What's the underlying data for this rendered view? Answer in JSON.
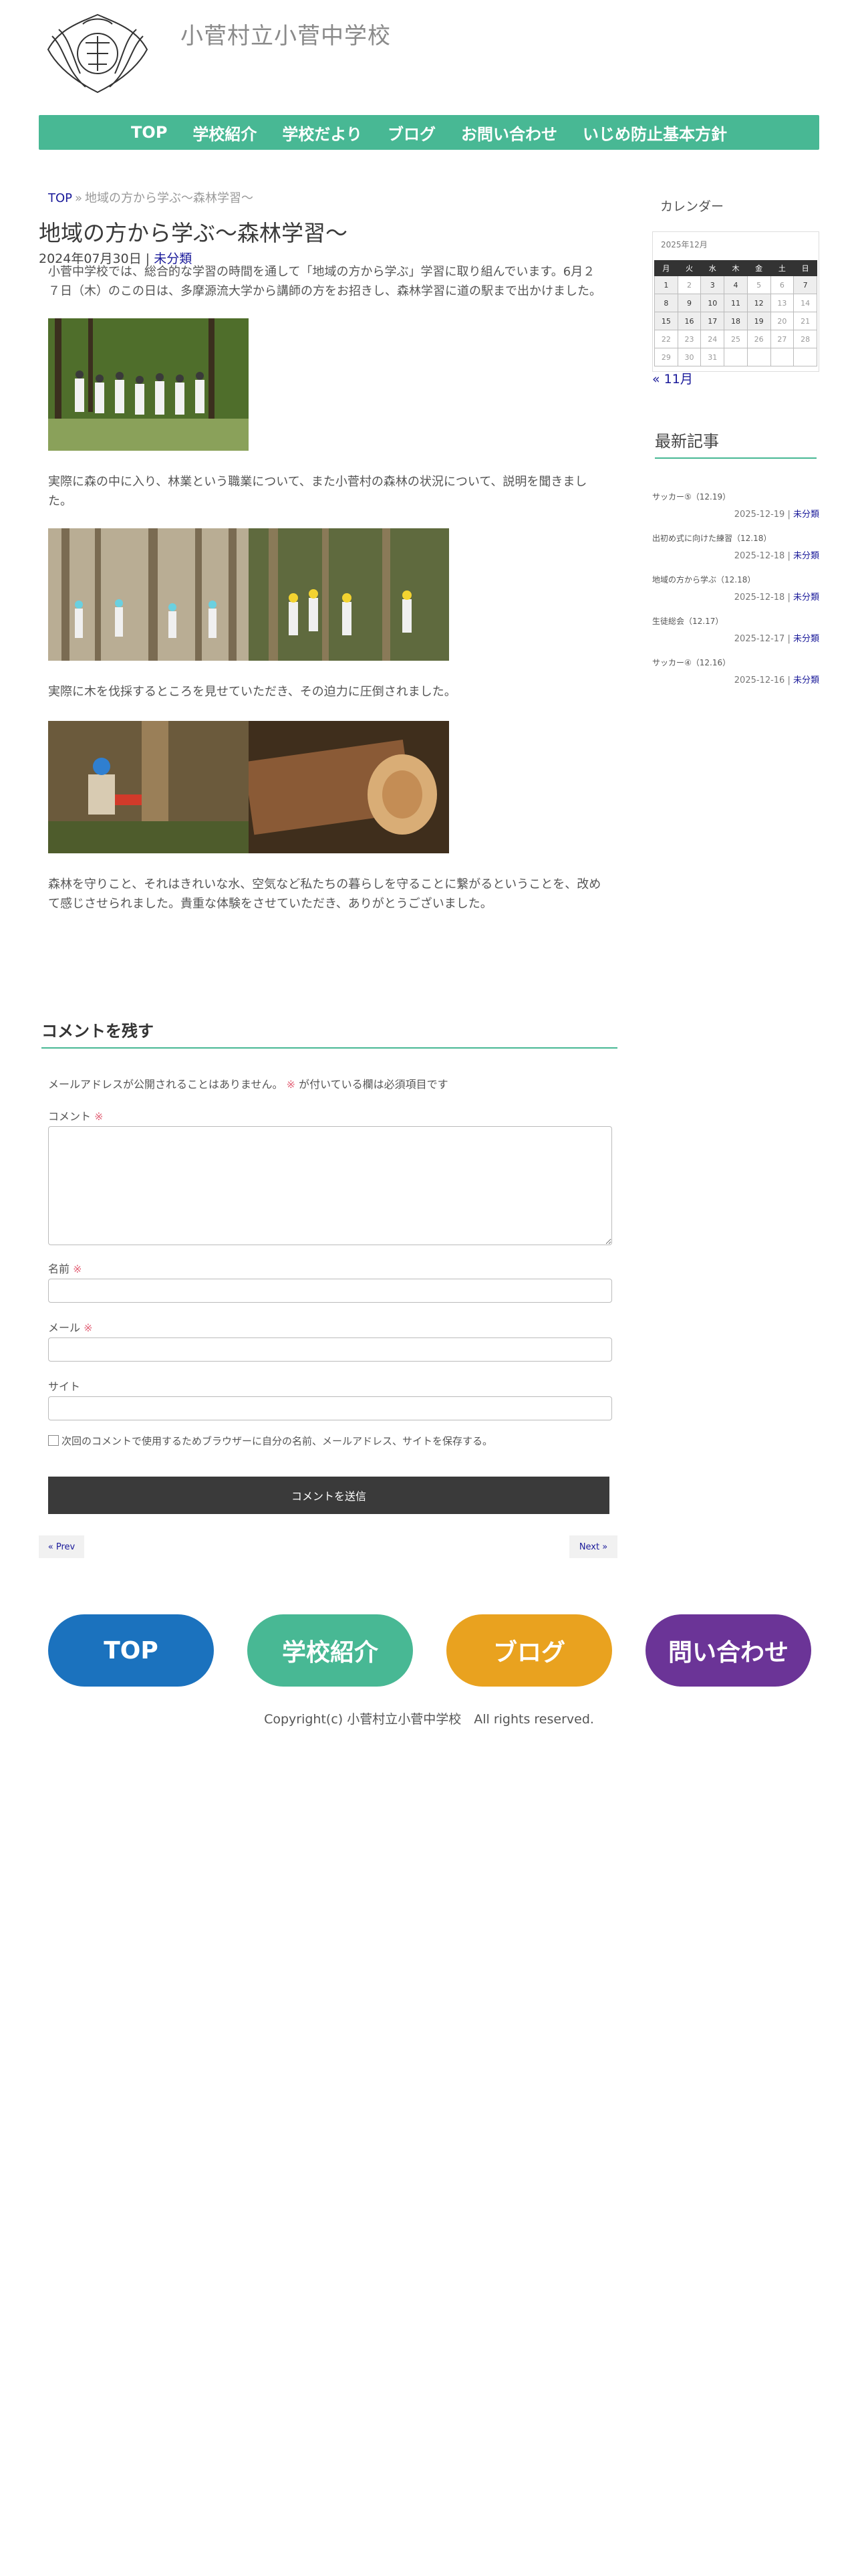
{
  "site": {
    "title": "小菅村立小菅中学校"
  },
  "nav": {
    "items": [
      "TOP",
      "学校紹介",
      "学校だより",
      "ブログ",
      "お問い合わせ",
      "いじめ防止基本方針"
    ]
  },
  "breadcrumb": {
    "home": "TOP",
    "sep": "»",
    "current": "地域の方から学ぶ〜森林学習〜"
  },
  "post": {
    "title": "地域の方から学ぶ〜森林学習〜",
    "date": "2024年07月30日",
    "meta_sep": "|",
    "category": "未分類",
    "paragraphs": [
      "小菅中学校では、総合的な学習の時間を通して「地域の方から学ぶ」学習に取り組んでいます。6月２７日（木）のこの日は、多摩源流大学から講師の方をお招きし、森林学習に道の駅まで出かけました。",
      "実際に森の中に入り、林業という職業について、また小菅村の森林の状況について、説明を聞きました。",
      "実際に木を伐採するところを見せていただき、その迫力に圧倒されました。",
      "森林を守りこと、それはきれいな水、空気など私たちの暮らしを守ることに繋がるということを、改めて感じさせられました。貴重な体験をさせていただき、ありがとうございました。"
    ]
  },
  "comments": {
    "heading": "コメントを残す",
    "notes_before": "メールアドレスが公開されることはありません。",
    "required_mark": "※",
    "notes_after": "が付いている欄は必須項目です",
    "comment_label": "コメント",
    "name_label": "名前",
    "email_label": "メール",
    "site_label": "サイト",
    "save_label": "次回のコメントで使用するためブラウザーに自分の名前、メールアドレス、サイトを保存する。",
    "submit_label": "コメントを送信"
  },
  "pager": {
    "prev": "« Prev",
    "next": "Next »"
  },
  "sidebar": {
    "calendar_heading": "カレンダー",
    "calendar_caption": "2025年12月",
    "weekdays": [
      "月",
      "火",
      "水",
      "木",
      "金",
      "土",
      "日"
    ],
    "weeks": [
      [
        "1",
        "2",
        "3",
        "4",
        "5",
        "6",
        "7"
      ],
      [
        "8",
        "9",
        "10",
        "11",
        "12",
        "13",
        "14"
      ],
      [
        "15",
        "16",
        "17",
        "18",
        "19",
        "20",
        "21"
      ],
      [
        "22",
        "23",
        "24",
        "25",
        "26",
        "27",
        "28"
      ],
      [
        "29",
        "30",
        "31",
        "",
        "",
        "",
        ""
      ]
    ],
    "days_with_posts": [
      "1",
      "3",
      "4",
      "7",
      "8",
      "9",
      "10",
      "11",
      "12",
      "15",
      "16",
      "17",
      "18",
      "19"
    ],
    "prev_month": "« 11月",
    "recent_heading": "最新記事",
    "recent_posts": [
      {
        "title": "サッカー⑤（12.19）",
        "date": "2025-12-19",
        "category": "未分類"
      },
      {
        "title": "出初め式に向けた練習（12.18）",
        "date": "2025-12-18",
        "category": "未分類"
      },
      {
        "title": "地域の方から学ぶ（12.18）",
        "date": "2025-12-18",
        "category": "未分類"
      },
      {
        "title": "生徒総会（12.17）",
        "date": "2025-12-17",
        "category": "未分類"
      },
      {
        "title": "サッカー④（12.16）",
        "date": "2025-12-16",
        "category": "未分類"
      }
    ]
  },
  "footer": {
    "buttons": [
      "TOP",
      "学校紹介",
      "ブログ",
      "問い合わせ"
    ],
    "colors": [
      "#1b72be",
      "#48b894",
      "#e9a21f",
      "#6b3497"
    ],
    "copyright": "Copyright(c) 小菅村立小菅中学校　All rights reserved."
  },
  "colors": {
    "accent": "#48b894",
    "link": "#1a1a9a",
    "required": "#e3687c"
  }
}
